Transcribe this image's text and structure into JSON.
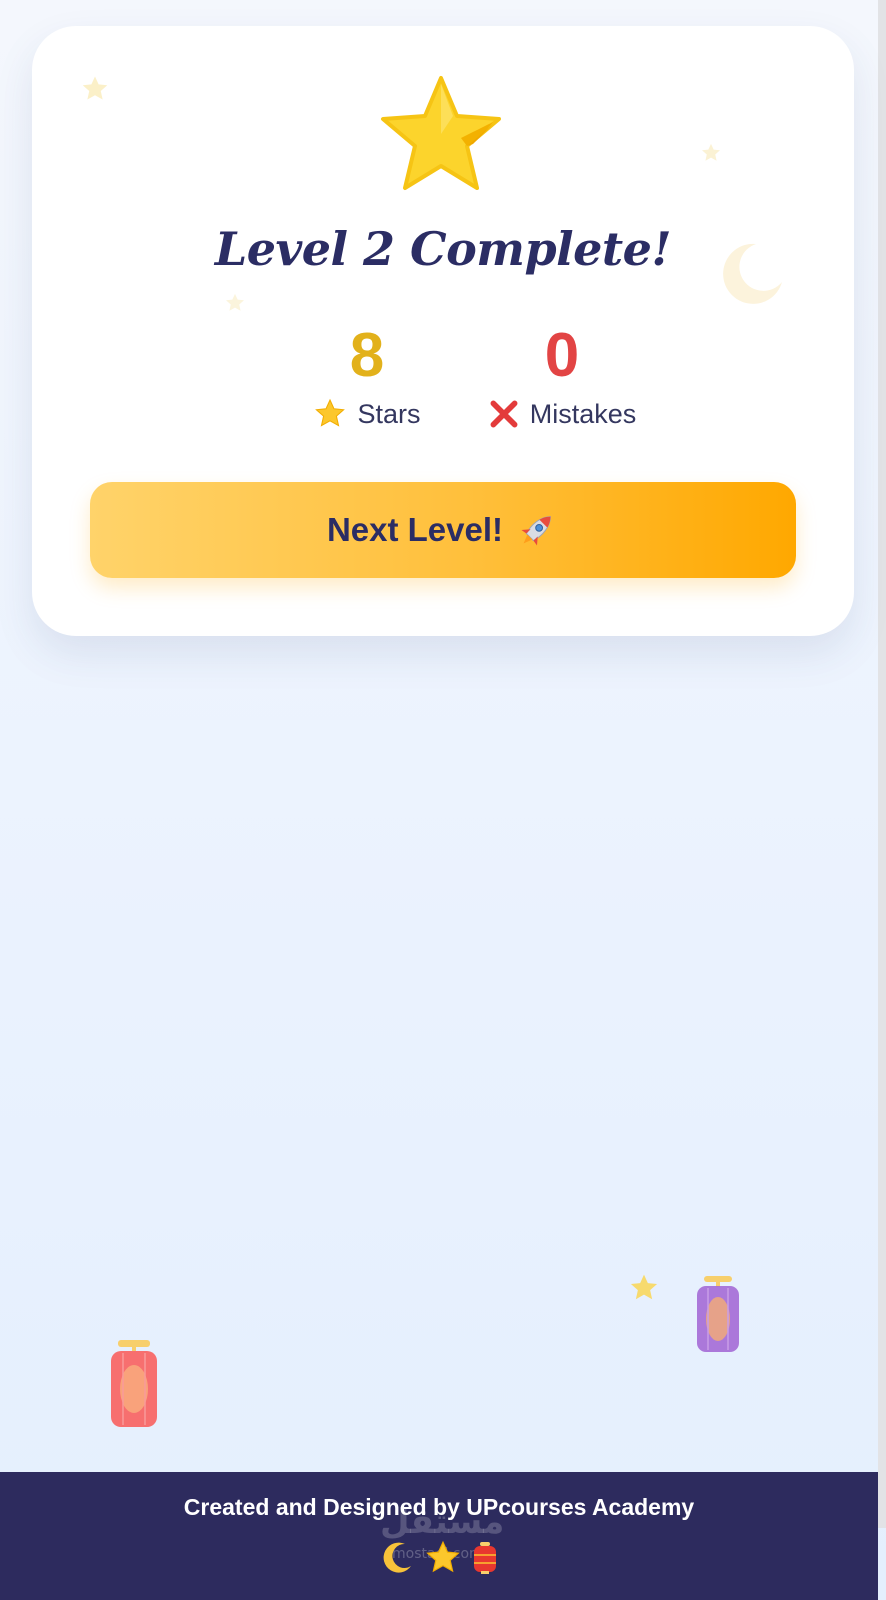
{
  "card": {
    "title": "Level 2 Complete!",
    "stats": {
      "stars": {
        "value": "8",
        "label": "Stars",
        "icon": "star-icon"
      },
      "mistakes": {
        "value": "0",
        "label": "Mistakes",
        "icon": "cross-mark-icon"
      }
    },
    "next_button": {
      "label": "Next Level!",
      "icon": "rocket-icon"
    }
  },
  "footer": {
    "credit": "Created and Designed by UPcourses Academy",
    "icons": [
      "crescent-moon-icon",
      "star-icon",
      "lantern-icon"
    ],
    "watermark": "مستقل",
    "watermark_sub": "mostaql.com"
  },
  "colors": {
    "title": "#2b2d64",
    "stars_value": "#e2b11b",
    "mistakes_value": "#e24444",
    "button_start": "#ffd36a",
    "button_end": "#ffa800",
    "footer_bg": "#2d2b5e"
  }
}
